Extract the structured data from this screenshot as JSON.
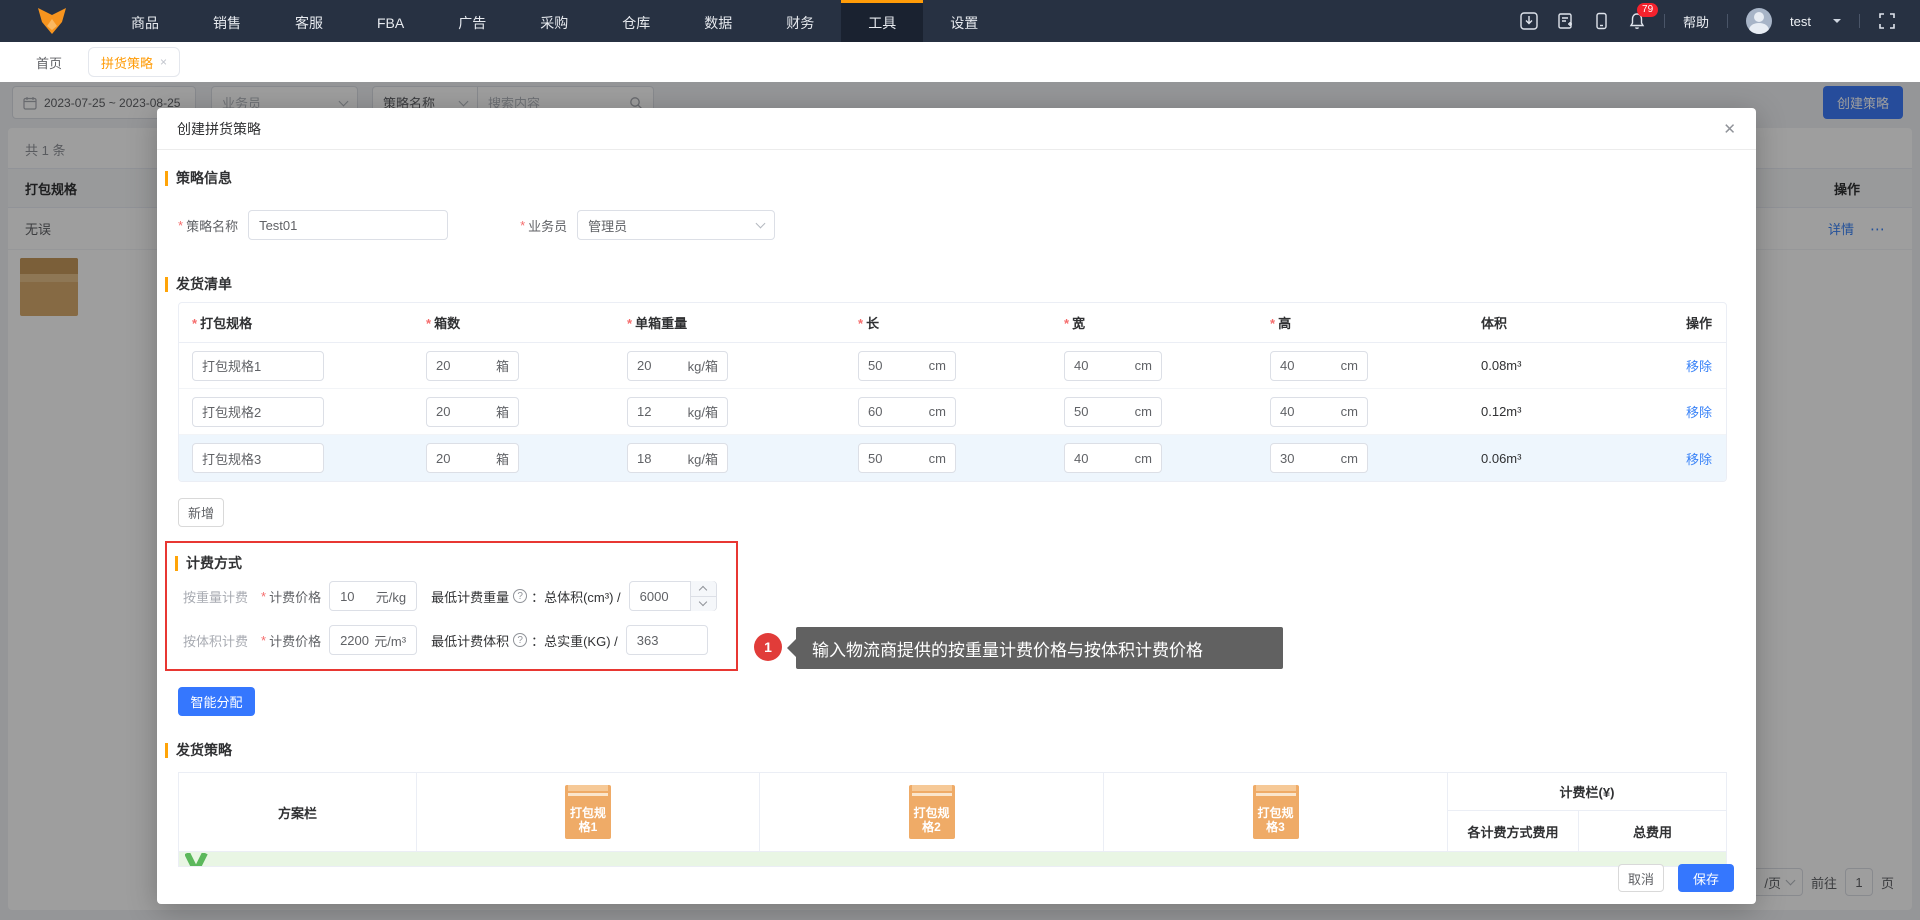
{
  "ui": {
    "required": "*"
  },
  "icons": {
    "close": "✕",
    "tab_close": "×",
    "more": "⋯",
    "help_q": "?",
    "arrow_left": "‹",
    "arrow_right": "›"
  },
  "topbar": {
    "nav": [
      "商品",
      "销售",
      "客服",
      "FBA",
      "广告",
      "采购",
      "仓库",
      "数据",
      "财务",
      "工具",
      "设置"
    ],
    "badge": "79",
    "help": "帮助",
    "user": "test"
  },
  "tabs": {
    "home": "首页",
    "current": "拼货策略"
  },
  "filters": {
    "date_range": "2023-07-25 ~ 2023-08-25",
    "salesman_placeholder": "业务员",
    "strategy_name": "策略名称",
    "search_placeholder": "搜索内容",
    "create_button": "创建策略"
  },
  "list": {
    "total": "共 1 条",
    "col_spec": "打包规格",
    "col_action": "操作",
    "row_name": "无误",
    "detail_link": "详情"
  },
  "pagination": {
    "per_page": "/页",
    "goto": "前往",
    "page": "1",
    "page_unit": "页"
  },
  "modal": {
    "title": "创建拼货策略",
    "sections": {
      "info": "策略信息",
      "list": "发货清单",
      "billing": "计费方式",
      "strategy": "发货策略"
    },
    "info": {
      "name_label": "策略名称",
      "name_value": "Test01",
      "salesman_label": "业务员",
      "salesman_value": "管理员"
    },
    "shipping": {
      "headers": [
        "打包规格",
        "箱数",
        "单箱重量",
        "长",
        "宽",
        "高",
        "体积",
        "操作"
      ],
      "units": {
        "boxes": "箱",
        "weight": "kg/箱",
        "cm": "cm"
      },
      "rows": [
        {
          "spec": "打包规格1",
          "boxes": "20",
          "weight": "20",
          "length": "50",
          "width": "40",
          "height": "40",
          "volume": "0.08m³",
          "action": "移除"
        },
        {
          "spec": "打包规格2",
          "boxes": "20",
          "weight": "12",
          "length": "60",
          "width": "50",
          "height": "40",
          "volume": "0.12m³",
          "action": "移除"
        },
        {
          "spec": "打包规格3",
          "boxes": "20",
          "weight": "18",
          "length": "50",
          "width": "40",
          "height": "30",
          "volume": "0.06m³",
          "action": "移除"
        }
      ],
      "add_button": "新增"
    },
    "billing": {
      "weight_label": "按重量计费",
      "volume_label": "按体积计费",
      "price_label": "计费价格",
      "weight_price": "10",
      "weight_unit": "元/kg",
      "min_weight_label": "最低计费重量",
      "min_weight_formula": "：总体积(cm³) /",
      "min_weight_value": "6000",
      "volume_price": "2200",
      "volume_unit": "元/m³",
      "min_volume_label": "最低计费体积",
      "min_volume_formula": "：总实重(KG) /",
      "min_volume_value": "363"
    },
    "annotation": {
      "number": "1",
      "text": "输入物流商提供的按重量计费价格与按体积计费价格"
    },
    "smart_button": "智能分配",
    "strategy": {
      "plan_col": "方案栏",
      "specs": [
        "打包规格1",
        "打包规格2",
        "打包规格3"
      ],
      "billing_col": "计费栏(¥)",
      "sub_cols": [
        "各计费方式费用",
        "总费用"
      ]
    },
    "footer": {
      "cancel": "取消",
      "save": "保存"
    }
  }
}
